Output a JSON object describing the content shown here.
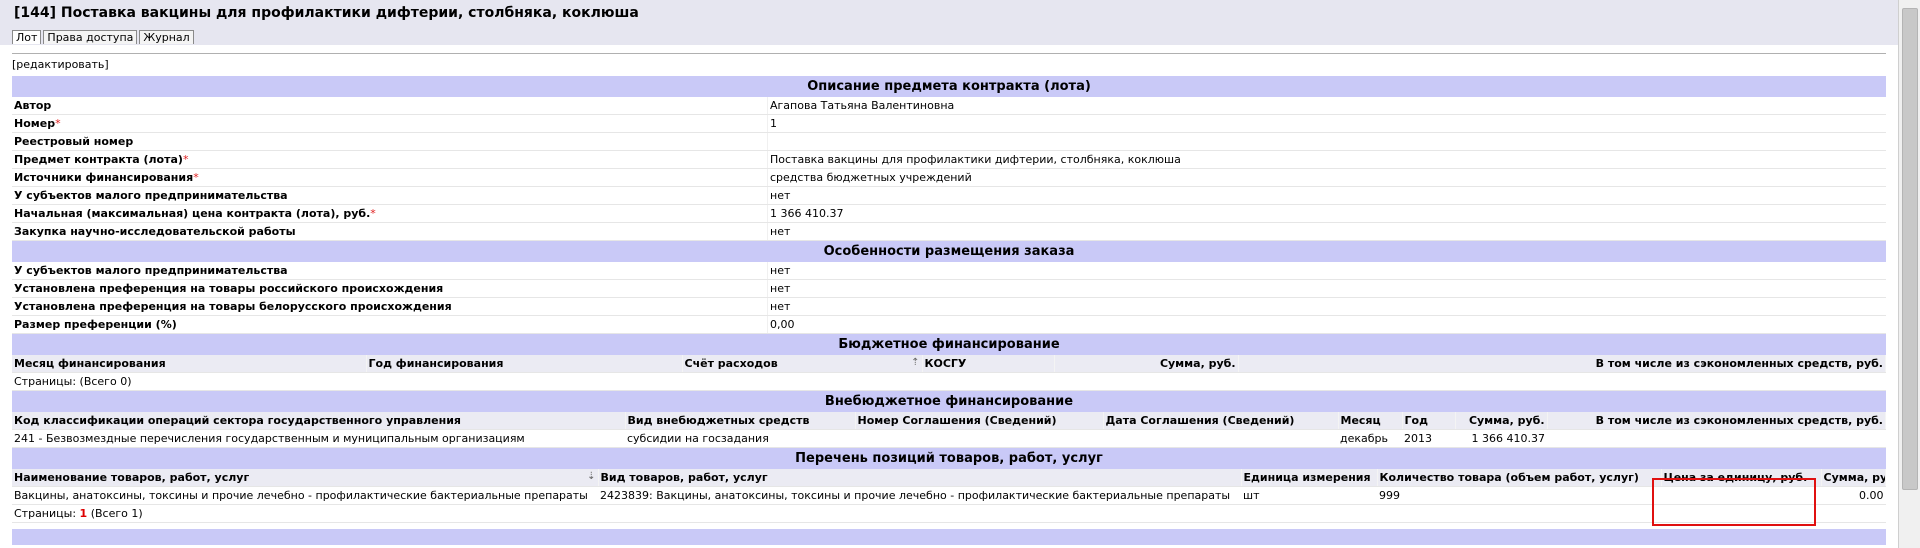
{
  "page_title": "[144] Поставка вакцины для профилактики дифтерии, столбняка, коклюша",
  "tabs": [
    "Лот",
    "Права доступа",
    "Журнал"
  ],
  "edit_link": "[редактировать]",
  "sections": {
    "description": "Описание предмета контракта (лота)",
    "placement": "Особенности размещения заказа",
    "budget": "Бюджетное финансирование",
    "extrabudget": "Внебюджетное финансирование",
    "items": "Перечень позиций товаров, работ, услуг"
  },
  "description_rows": [
    {
      "label": "Автор",
      "required": "",
      "value": "Агапова Татьяна Валентиновна"
    },
    {
      "label": "Номер",
      "required": "*",
      "value": "1"
    },
    {
      "label": "Реестровый номер",
      "required": "",
      "value": ""
    },
    {
      "label": "Предмет контракта (лота)",
      "required": "*",
      "value": "Поставка вакцины для профилактики дифтерии, столбняка, коклюша"
    },
    {
      "label": "Источники финансирования",
      "required": "*",
      "value": "средства бюджетных учреждений"
    },
    {
      "label": "У субъектов малого предпринимательства",
      "required": "",
      "value": "нет"
    },
    {
      "label": "Начальная (максимальная) цена контракта (лота), руб.",
      "required": "*",
      "value": "1 366 410.37"
    },
    {
      "label": "Закупка научно-исследовательской работы",
      "required": "",
      "value": "нет"
    }
  ],
  "placement_rows": [
    {
      "label": "У субъектов малого предпринимательства",
      "value": "нет"
    },
    {
      "label": "Установлена преференция на товары российского происхождения",
      "value": "нет"
    },
    {
      "label": "Установлена преференция на товары белорусского происхождения",
      "value": "нет"
    },
    {
      "label": "Размер преференции (%)",
      "value": "0,00"
    }
  ],
  "budget": {
    "headers": [
      "Месяц финансирования",
      "Год финансирования",
      "Счёт расходов",
      "КОСГУ",
      "Сумма, руб.",
      "В том числе из сэкономленных средств, руб."
    ],
    "pager_label": "Страницы:",
    "pager_total": "(Всего 0)"
  },
  "extrabudget": {
    "headers": [
      "Код классификации операций сектора государственного управления",
      "Вид внебюджетных средств",
      "Номер Соглашения (Сведений)",
      "Дата Соглашения (Сведений)",
      "Месяц",
      "Год",
      "Сумма, руб.",
      "В том числе из сэкономленных средств, руб."
    ],
    "row": [
      "241 - Безвозмездные перечисления государственным и муниципальным организациям",
      "субсидии на госзадания",
      "",
      "",
      "декабрь",
      "2013",
      "1 366 410.37",
      ""
    ]
  },
  "items": {
    "headers": [
      "Наименование товаров, работ, услуг",
      "Вид товаров, работ, услуг",
      "Единица измерения",
      "Количество товара (объем работ, услуг)",
      "Цена за единицу, руб.",
      "Сумма, руб."
    ],
    "row": [
      "Вакцины, анатоксины, токсины и прочие лечебно - профилактические бактериальные препараты",
      "2423839: Вакцины, анатоксины, токсины и прочие лечебно - профилактические бактериальные препараты",
      "шт",
      "999",
      "",
      "0.00"
    ],
    "pager_label": "Страницы:",
    "pager_page": "1",
    "pager_total": "(Всего 1)"
  },
  "colors": {
    "section_bg": "#c9c9f7",
    "header_bg": "#ebebf3",
    "required": "#e02020",
    "highlight": "#e01010"
  }
}
